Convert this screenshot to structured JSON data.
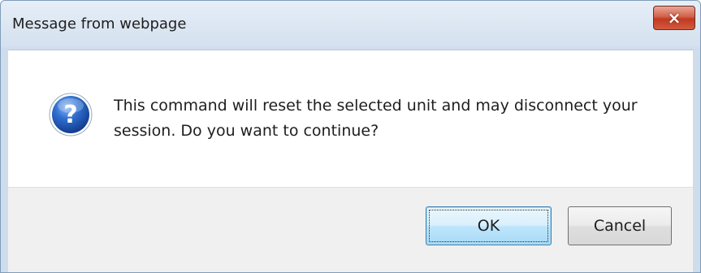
{
  "dialog": {
    "title": "Message from webpage",
    "close_glyph": "×",
    "icon": "question-icon",
    "message": "This command will reset the selected unit and may disconnect your session. Do you want to continue?",
    "ok_label": "OK",
    "cancel_label": "Cancel"
  },
  "colors": {
    "close_button": "#c13a22",
    "ok_button_border": "#3c7fb1",
    "question_icon_blue": "#1c56b8"
  }
}
